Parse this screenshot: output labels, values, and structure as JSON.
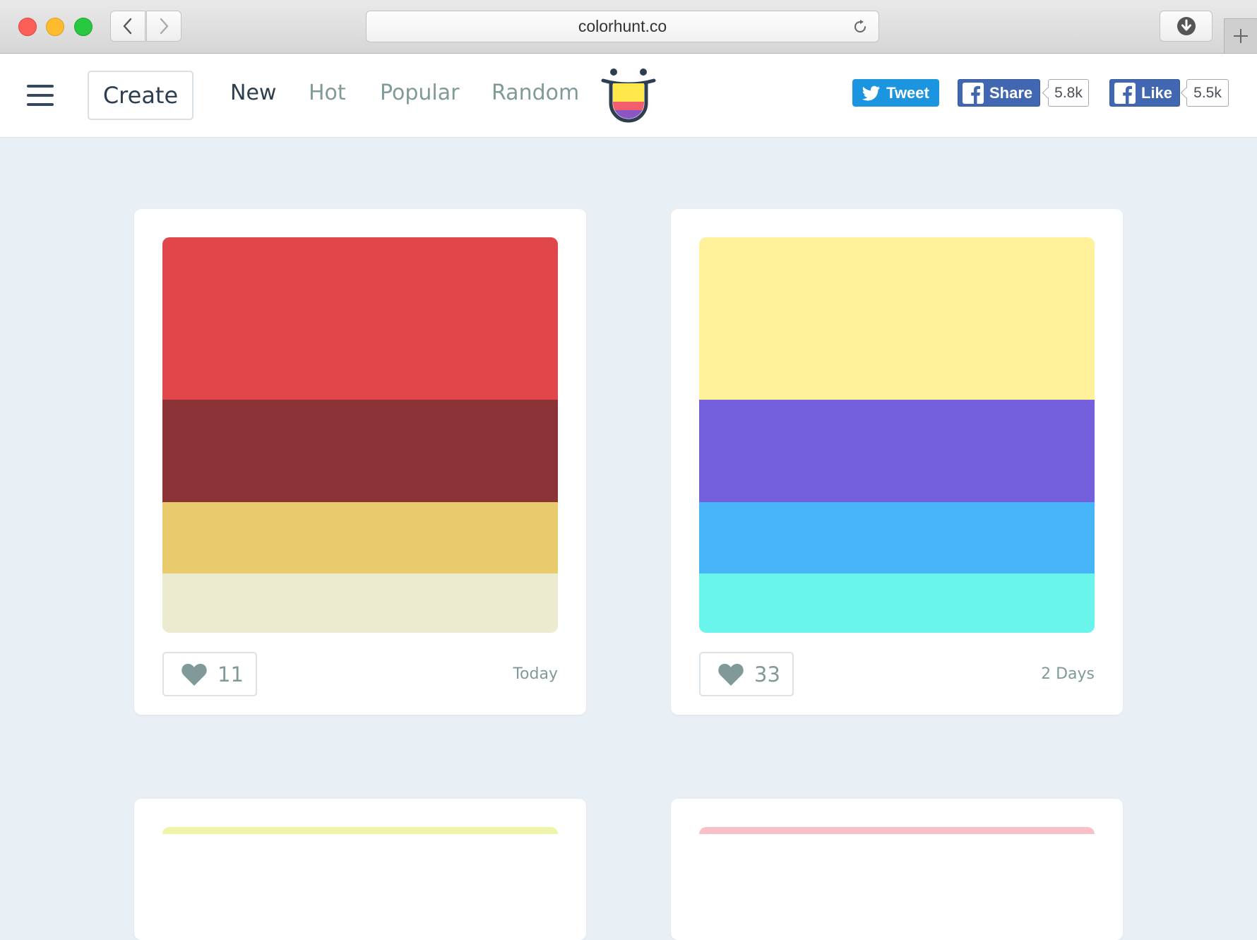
{
  "browser": {
    "url": "colorhunt.co"
  },
  "header": {
    "create_label": "Create",
    "nav": [
      {
        "label": "New"
      },
      {
        "label": "Hot"
      },
      {
        "label": "Popular"
      },
      {
        "label": "Random"
      }
    ],
    "tweet_label": "Tweet",
    "share_label": "Share",
    "share_count": "5.8k",
    "like_label": "Like",
    "like_count": "5.5k"
  },
  "palettes": [
    {
      "colors": [
        "#e0464a",
        "#8b3337",
        "#e8cb6d",
        "#ebebcf"
      ],
      "likes": "11",
      "date": "Today"
    },
    {
      "colors": [
        "#fff09a",
        "#7460dc",
        "#48b4f8",
        "#6af5ec"
      ],
      "likes": "33",
      "date": "2 Days"
    },
    {
      "colors": [
        "#eef5a8"
      ]
    },
    {
      "colors": [
        "#f9c0c8"
      ]
    }
  ]
}
